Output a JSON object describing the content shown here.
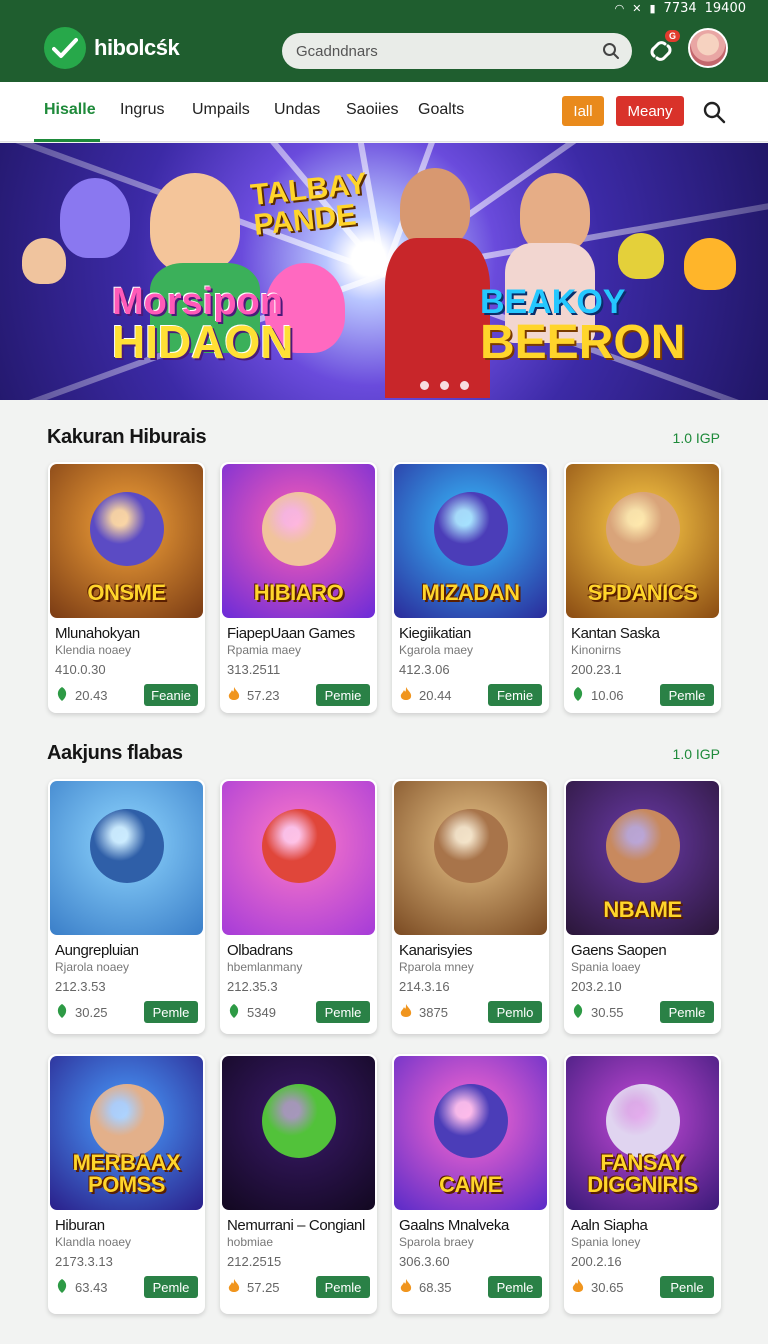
{
  "status_bar": {
    "text_1": "7734",
    "text_2": "19400"
  },
  "header": {
    "logo_text": "hibolcśk",
    "search_placeholder": "Gcadndnars",
    "notification_badge": "G"
  },
  "nav": {
    "items": [
      "Hisalle",
      "Ingrus",
      "Umpails",
      "Undas",
      "Saoiies",
      "Goalts"
    ],
    "active_index": 0,
    "orange_button": "Iall",
    "red_button": "Meany"
  },
  "banner": {
    "title_left_1": "Morsipon",
    "title_left_2": "HIDAON",
    "title_top_1": "TALBAY",
    "title_top_2": "PANDE",
    "title_right_1": "BEAKOY",
    "title_right_2": "BEERON",
    "slide_count": 3
  },
  "sections": [
    {
      "title": "Kakuran Hiburais",
      "link": "1.0 IGP",
      "cards": [
        {
          "art": "ONSME",
          "name": "Mlunahokyan",
          "sub": "Klendia noaey",
          "num": "410.0.30",
          "rating": "20.43",
          "icon": "leaf",
          "button": "Feanie",
          "bg": [
            "#f5a43a",
            "#7a3b14"
          ],
          "face": "#5b4bc4"
        },
        {
          "art": "HIBIARO",
          "name": "FiapepUaan Games",
          "sub": "Rpamia maey",
          "num": "313.2511",
          "rating": "57.23",
          "icon": "flame",
          "button": "Pemie",
          "bg": [
            "#ff5fb4",
            "#6b2bd8"
          ],
          "face": "#f1c39c"
        },
        {
          "art": "MIZADAN",
          "name": "Kiegiikatian",
          "sub": "Kgarola maey",
          "num": "412.3.06",
          "rating": "20.44",
          "icon": "flame",
          "button": "Femie",
          "bg": [
            "#39c0ff",
            "#2a2a9a"
          ],
          "face": "#4b3db8"
        },
        {
          "art": "SPDANICS",
          "name": "Kantan Saska",
          "sub": "Kinonirns",
          "num": "200.23.1",
          "rating": "10.06",
          "icon": "leaf",
          "button": "Pemle",
          "bg": [
            "#ffcf4a",
            "#8a4b12"
          ],
          "face": "#d9a47a"
        }
      ]
    },
    {
      "title": "Aakjuns flabas",
      "link": "1.0 IGP",
      "cards": [
        {
          "art": "",
          "name": "Aungrepluian",
          "sub": "Rjarola noaey",
          "num": "212.3.53",
          "rating": "30.25",
          "icon": "leaf",
          "button": "Pemle",
          "bg": [
            "#8fd6ff",
            "#3a7ec8"
          ],
          "face": "#2f5fa8"
        },
        {
          "art": "",
          "name": "Olbadrans",
          "sub": "hbemlanmany",
          "num": "212.35.3",
          "rating": "5349",
          "icon": "leaf",
          "button": "Pemle",
          "bg": [
            "#ff7ac8",
            "#a53bd8"
          ],
          "face": "#e0463a"
        },
        {
          "art": "",
          "name": "Kanarisyies",
          "sub": "Rparola mney",
          "num": "214.3.16",
          "rating": "3875",
          "icon": "flame",
          "button": "Pemlo",
          "bg": [
            "#e9c58a",
            "#7a4a22"
          ],
          "face": "#a8744a"
        },
        {
          "art": "NBAME",
          "name": "Gaens Saopen",
          "sub": "Spania loaey",
          "num": "203.2.10",
          "rating": "30.55",
          "icon": "leaf",
          "button": "Pemle",
          "bg": [
            "#6a3aa8",
            "#2a1638"
          ],
          "face": "#c8895e"
        }
      ]
    },
    {
      "title": "",
      "link": "",
      "cards": [
        {
          "art": "MERBAAX POMSS",
          "name": "Hiburan",
          "sub": "Klandla noaey",
          "num": "2173.3.13",
          "rating": "63.43",
          "icon": "leaf",
          "button": "Pemle",
          "bg": [
            "#4aa0ff",
            "#2a1f8a"
          ],
          "face": "#e3b08a"
        },
        {
          "art": "",
          "name": "Nemurrani – Congianl",
          "sub": "hobmiae",
          "num": "212.2515",
          "rating": "57.25",
          "icon": "flame",
          "button": "Pemle",
          "bg": [
            "#3a1a6a",
            "#120820"
          ],
          "face": "#52c23a"
        },
        {
          "art": "CAME",
          "name": "Gaalns Mnalveka",
          "sub": "Sparola braey",
          "num": "306.3.60",
          "rating": "68.35",
          "icon": "flame",
          "button": "Pemle",
          "bg": [
            "#ff6ad0",
            "#5a2bc8"
          ],
          "face": "#4b3db8"
        },
        {
          "art": "FANSAY DIGGNIRIS",
          "name": "Aaln Siapha",
          "sub": "Spania loney",
          "num": "200.2.16",
          "rating": "30.65",
          "icon": "flame",
          "button": "Penle",
          "bg": [
            "#c54ad8",
            "#3a1a78"
          ],
          "face": "#e0d4f0"
        }
      ]
    }
  ]
}
